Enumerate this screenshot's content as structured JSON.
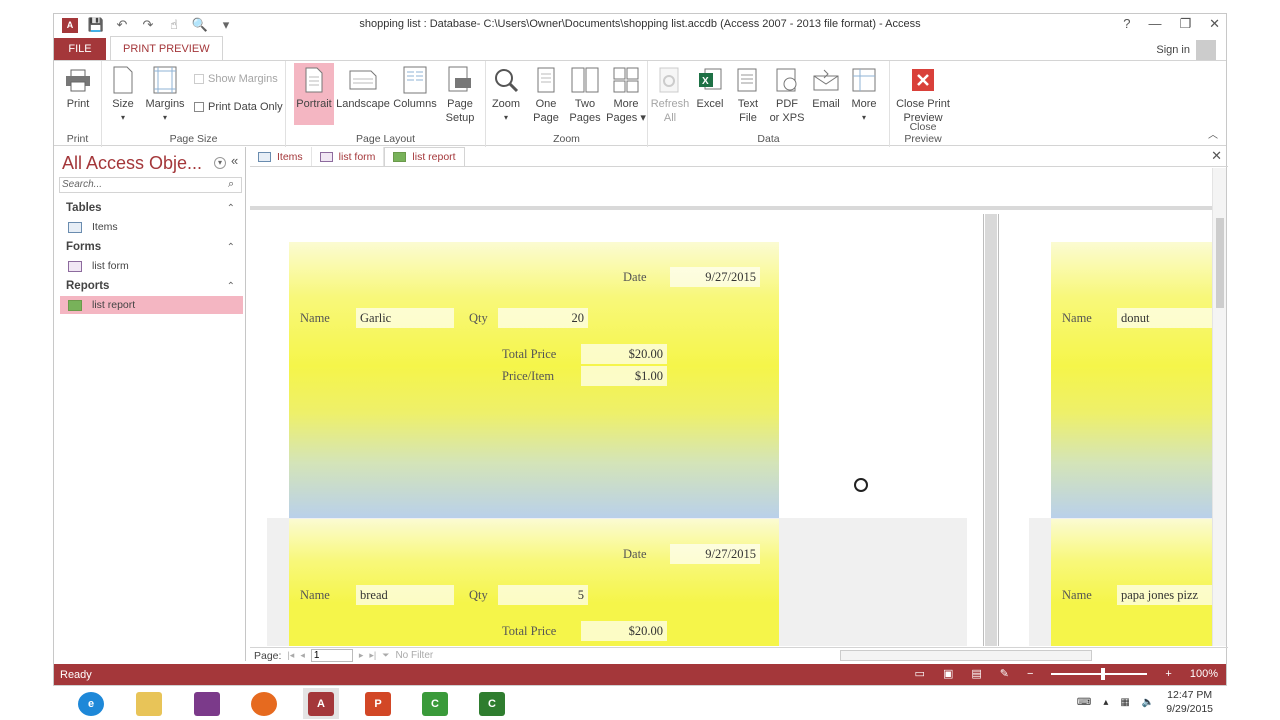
{
  "window": {
    "title": "shopping list : Database- C:\\Users\\Owner\\Documents\\shopping list.accdb (Access 2007 - 2013 file format) - Access",
    "help": "?",
    "minimize": "—",
    "restore": "❐",
    "close": "✕"
  },
  "qat": {
    "app_logo": "A",
    "save_icon": "💾",
    "undo_icon": "↶",
    "redo_icon": "↷",
    "touch_icon": "☝",
    "preview_icon": "🔍",
    "customize_icon": "▾"
  },
  "tabs": {
    "file": "FILE",
    "print_preview": "PRINT PREVIEW"
  },
  "account": {
    "sign_in": "Sign in"
  },
  "ribbon": {
    "print": {
      "print": "Print",
      "label": "Print"
    },
    "page_size": {
      "size": "Size",
      "margins": "Margins",
      "show_margins": "Show Margins",
      "print_data_only": "Print Data Only",
      "label": "Page Size"
    },
    "page_layout": {
      "portrait": "Portrait",
      "landscape": "Landscape",
      "columns": "Columns",
      "page_setup_1": "Page",
      "page_setup_2": "Setup",
      "label": "Page Layout"
    },
    "zoom": {
      "zoom": "Zoom",
      "one_page_1": "One",
      "one_page_2": "Page",
      "two_pages_1": "Two",
      "two_pages_2": "Pages",
      "more_pages_1": "More",
      "more_pages_2": "Pages ▾",
      "label": "Zoom"
    },
    "data": {
      "refresh_1": "Refresh",
      "refresh_2": "All",
      "excel": "Excel",
      "text_file_1": "Text",
      "text_file_2": "File",
      "pdf_1": "PDF",
      "pdf_2": "or XPS",
      "email": "Email",
      "more": "More",
      "label": "Data"
    },
    "close_preview": {
      "close_1": "Close Print",
      "close_2": "Preview",
      "label": "Close Preview"
    }
  },
  "nav": {
    "title": "All Access Obje...",
    "search_placeholder": "Search...",
    "groups": [
      {
        "header": "Tables",
        "items": [
          "Items"
        ]
      },
      {
        "header": "Forms",
        "items": [
          "list form"
        ]
      },
      {
        "header": "Reports",
        "items": [
          "list report"
        ]
      }
    ]
  },
  "doc_tabs": [
    "Items",
    "list form",
    "list report"
  ],
  "report": {
    "records": [
      {
        "date_label": "Date",
        "date": "9/27/2015",
        "name_label": "Name",
        "name": "Garlic",
        "qty_label": "Qty",
        "qty": "20",
        "total_label": "Total Price",
        "total": "$20.00",
        "ppi_label": "Price/Item",
        "ppi": "$1.00"
      },
      {
        "date_label": "Date",
        "date": "9/27/2015",
        "name_label": "Name",
        "name": "bread",
        "qty_label": "Qty",
        "qty": "5",
        "total_label": "Total Price",
        "total": "$20.00"
      }
    ],
    "page2_records": [
      {
        "name_label": "Name",
        "name": "donut"
      },
      {
        "name_label": "Name",
        "name": "papa jones pizz"
      }
    ]
  },
  "record_nav": {
    "label": "Page:",
    "page": "1",
    "no_filter": "No Filter"
  },
  "status": {
    "text": "Ready",
    "zoom": "100%"
  },
  "taskbar": {
    "time": "12:47 PM",
    "date": "9/29/2015"
  },
  "colors": {
    "accent": "#a4373a",
    "selected": "#f4b6c2"
  }
}
